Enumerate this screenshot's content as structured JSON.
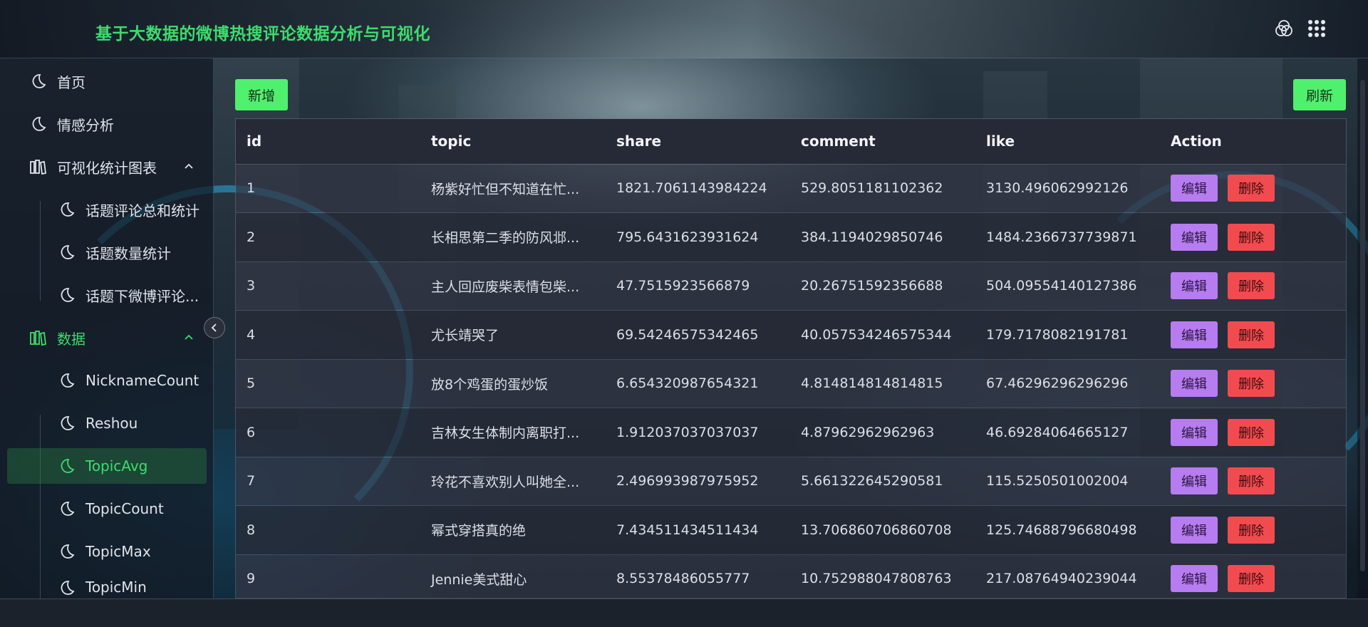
{
  "app_title": "基于大数据的微博热搜评论数据分析与可视化",
  "header_icons": [
    "theme-circles-icon",
    "apps-grid-icon"
  ],
  "sidebar": {
    "items": [
      {
        "label": "首页",
        "icon": "moon-icon",
        "level": 1
      },
      {
        "label": "情感分析",
        "icon": "moon-icon",
        "level": 1
      },
      {
        "label": "可视化统计图表",
        "icon": "library-icon",
        "level": 1,
        "expanded": true
      },
      {
        "label": "话题评论总和统计",
        "icon": "moon-icon",
        "level": 2
      },
      {
        "label": "话题数量统计",
        "icon": "moon-icon",
        "level": 2
      },
      {
        "label": "话题下微博评论...",
        "icon": "moon-icon",
        "level": 2
      },
      {
        "label": "数据",
        "icon": "library-icon",
        "level": 1,
        "expanded": true,
        "active": true
      },
      {
        "label": "NicknameCount",
        "icon": "moon-icon",
        "level": 2
      },
      {
        "label": "Reshou",
        "icon": "moon-icon",
        "level": 2
      },
      {
        "label": "TopicAvg",
        "icon": "moon-icon",
        "level": 2,
        "selected": true
      },
      {
        "label": "TopicCount",
        "icon": "moon-icon",
        "level": 2
      },
      {
        "label": "TopicMax",
        "icon": "moon-icon",
        "level": 2
      },
      {
        "label": "TopicMin",
        "icon": "moon-icon",
        "level": 2
      }
    ]
  },
  "toolbar": {
    "add_label": "新增",
    "refresh_label": "刷新"
  },
  "table": {
    "columns": [
      "id",
      "topic",
      "share",
      "comment",
      "like",
      "Action"
    ],
    "rows": [
      {
        "id": "1",
        "topic": "杨紫好忙但不知道在忙...",
        "share": "1821.7061143984224",
        "comment": "529.8051181102362",
        "like": "3130.496062992126"
      },
      {
        "id": "2",
        "topic": "长相思第二季的防风邶...",
        "share": "795.6431623931624",
        "comment": "384.1194029850746",
        "like": "1484.2366737739871"
      },
      {
        "id": "3",
        "topic": "主人回应废柴表情包柴...",
        "share": "47.7515923566879",
        "comment": "20.26751592356688",
        "like": "504.09554140127386"
      },
      {
        "id": "4",
        "topic": "尤长靖哭了",
        "share": "69.54246575342465",
        "comment": "40.057534246575344",
        "like": "179.7178082191781"
      },
      {
        "id": "5",
        "topic": "放8个鸡蛋的蛋炒饭",
        "share": "6.654320987654321",
        "comment": "4.814814814814815",
        "like": "67.46296296296296"
      },
      {
        "id": "6",
        "topic": "吉林女生体制内离职打...",
        "share": "1.912037037037037",
        "comment": "4.87962962962963",
        "like": "46.69284064665127"
      },
      {
        "id": "7",
        "topic": "玲花不喜欢别人叫她全...",
        "share": "2.496993987975952",
        "comment": "5.661322645290581",
        "like": "115.5250501002004"
      },
      {
        "id": "8",
        "topic": "幂式穿搭真的绝",
        "share": "7.434511434511434",
        "comment": "13.706860706860708",
        "like": "125.74688796680498"
      },
      {
        "id": "9",
        "topic": "Jennie美式甜心",
        "share": "8.55378486055777",
        "comment": "10.752988047808763",
        "like": "217.08764940239044"
      }
    ],
    "edit_label": "编辑",
    "delete_label": "删除"
  },
  "colors": {
    "accent_green": "#3ddc6e",
    "button_green": "#4ff06d",
    "edit_purple": "#b67cf0",
    "delete_red": "#f24b4f"
  }
}
